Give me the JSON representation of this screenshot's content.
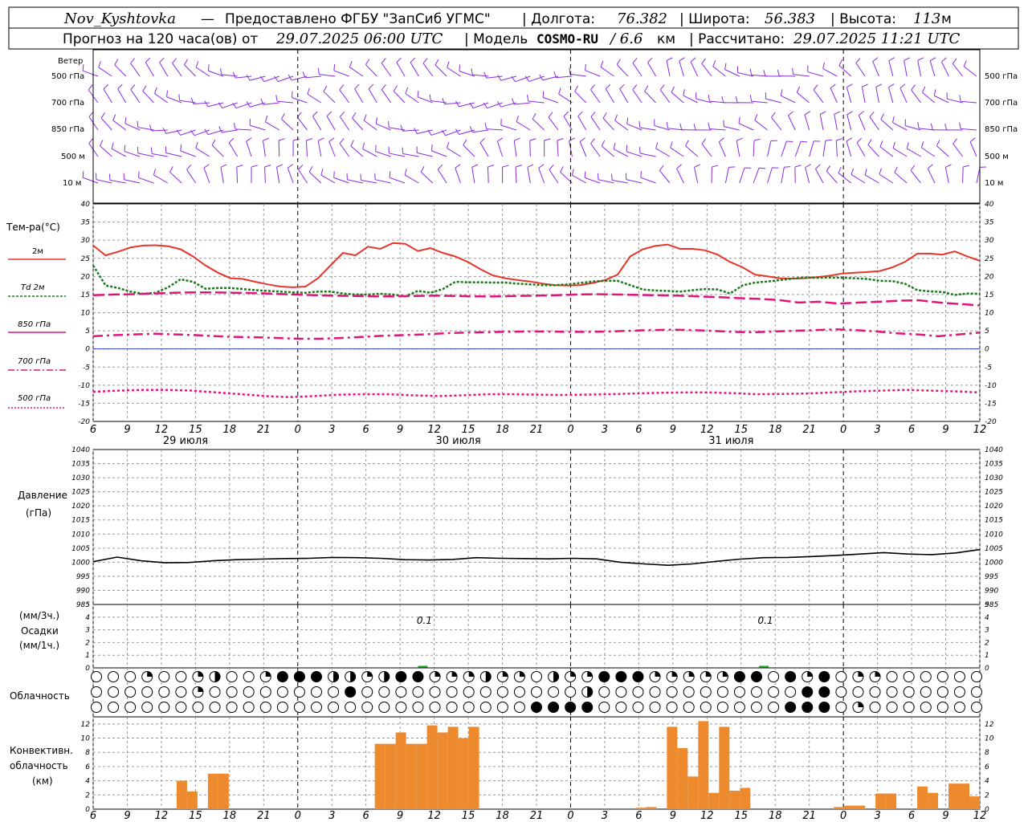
{
  "header": {
    "station": "Nov_Kyshtovka",
    "dash": "—",
    "provider": "Предоставлено ФГБУ \"ЗапСиб УГМС\"",
    "lon_label": "| Долгота:",
    "lon_value": "76.382",
    "lat_label": "| Широта:",
    "lat_value": "56.383",
    "alt_label": "| Высота:",
    "alt_value": "113",
    "alt_unit": "м",
    "forecast_label": "Прогноз на 120 часа(ов) от",
    "forecast_time": "29.07.2025 06:00 UTC",
    "model_label": "| Модель",
    "model_name": "COSMO-RU",
    "model_res": "/ 6.6",
    "model_res_unit": "км",
    "calc_label": "| Рассчитано:",
    "calc_time": "29.07.2025 11:21 UTC"
  },
  "wind_panel": {
    "title": "Ветер",
    "levels": [
      "500 гПа",
      "700 гПа",
      "850 гПа",
      "500 м",
      "10  м"
    ],
    "colors": {
      "barb": "#8a2be2"
    }
  },
  "temp_panel": {
    "title": "Тем-ра(°C)",
    "legend": [
      {
        "label": "2м",
        "color": "#e8352c",
        "style": "solid"
      },
      {
        "label": "Td  2м",
        "color": "#1a7a1a",
        "style": "dotted"
      },
      {
        "label": "850 гПа",
        "color": "#e0157a",
        "style": "dashed"
      },
      {
        "label": "700 гПа",
        "color": "#e0157a",
        "style": "dashdot"
      },
      {
        "label": "500 гПа",
        "color": "#e0157a",
        "style": "dotted"
      }
    ]
  },
  "pressure_panel": {
    "title1": "Давление",
    "title2": "(гПа)"
  },
  "precip_panel": {
    "title1": "(мм/3ч.)",
    "title2": "Осадки",
    "title3": "(мм/1ч.)"
  },
  "cloud_panel": {
    "title": "Облачность"
  },
  "conv_panel": {
    "title1": "Конвективн.",
    "title2": "облачность",
    "title3": "(км)"
  },
  "x_tick_labels": [
    "6",
    "9",
    "12",
    "15",
    "18",
    "21",
    "0",
    "3",
    "6",
    "9",
    "12",
    "15",
    "18",
    "21",
    "0",
    "3",
    "6",
    "9",
    "12",
    "15",
    "18",
    "21",
    "0",
    "3",
    "6",
    "9",
    "12"
  ],
  "date_labels": [
    "29 июля",
    "30 июля",
    "31 июля"
  ],
  "colors": {
    "t2m": "#e8352c",
    "td": "#1a7a1a",
    "upper": "#e0157a",
    "zero": "#3040e0",
    "pressure": "#000000",
    "conv": "#ee8a2e",
    "precip": "#22aa22",
    "grid": "#999999"
  },
  "chart_data": [
    {
      "type": "line",
      "title": "Тем-ра(°C)",
      "x_hours_from_start": [
        0,
        1,
        2,
        3,
        4,
        5,
        6,
        7,
        8,
        9,
        10,
        11,
        12,
        13,
        14,
        15,
        16,
        17,
        18,
        19,
        20,
        21,
        22,
        23,
        24,
        25,
        26,
        27,
        28,
        29,
        30,
        31,
        32,
        33,
        34,
        35,
        36,
        37,
        38,
        39,
        40,
        41,
        42,
        43,
        44,
        45,
        46,
        47,
        48,
        49,
        50,
        51,
        52,
        53,
        54,
        55,
        56,
        57,
        58,
        59,
        60,
        61,
        62,
        63,
        64,
        65,
        66,
        67,
        68,
        69,
        70,
        71,
        72,
        73,
        74,
        75,
        76,
        77,
        78
      ],
      "ylim": [
        -20,
        40
      ],
      "series": [
        {
          "name": "2м",
          "values": [
            28.5,
            25.8,
            26.8,
            28.0,
            28.5,
            28.6,
            28.3,
            27.5,
            25.5,
            23.0,
            21.0,
            19.5,
            19.3,
            18.5,
            17.8,
            17.2,
            17.0,
            17.2,
            19.5,
            23.0,
            26.5,
            25.8,
            28.2,
            27.6,
            29.2,
            29.0,
            27.0,
            27.8,
            26.5,
            25.5,
            24.0,
            22.0,
            20.3,
            19.5,
            19.0,
            18.6,
            18.0,
            17.6,
            17.5,
            17.6,
            18.2,
            19.0,
            20.5,
            25.5,
            27.5,
            28.4,
            28.8,
            27.6,
            27.6,
            27.2,
            26.0,
            24.0,
            22.5,
            20.5,
            20.0,
            19.5,
            19.4,
            19.5,
            19.8,
            20.2,
            20.8,
            21.0,
            21.2,
            21.5,
            22.5,
            24.0,
            26.3,
            26.3,
            26.0,
            26.9,
            25.5,
            24.3
          ]
        },
        {
          "name": "Td  2м",
          "values": [
            23.0,
            17.5,
            16.8,
            15.8,
            15.2,
            15.5,
            17.0,
            19.2,
            18.5,
            16.6,
            16.8,
            16.8,
            16.5,
            16.2,
            16.0,
            15.8,
            15.6,
            15.5,
            15.8,
            15.8,
            15.3,
            15.0,
            15.0,
            15.2,
            15.0,
            14.5,
            16.0,
            15.5,
            16.5,
            18.5,
            18.4,
            18.4,
            18.3,
            18.3,
            18.0,
            17.8,
            17.6,
            17.6,
            17.8,
            18.2,
            18.6,
            18.8,
            18.8,
            17.6,
            16.4,
            16.1,
            16.0,
            15.8,
            16.2,
            16.5,
            16.4,
            15.3,
            17.5,
            18.3,
            18.6,
            19.0,
            19.4,
            19.7,
            19.6,
            19.7,
            19.6,
            19.5,
            19.3,
            18.8,
            18.7,
            18.0,
            16.2,
            15.9,
            15.7,
            14.9,
            15.3,
            15.2
          ]
        },
        {
          "name": "850 гПа",
          "values": [
            14.8,
            15.0,
            15.1,
            15.3,
            15.5,
            15.6,
            15.6,
            15.5,
            15.4,
            15.2,
            15.0,
            14.8,
            14.7,
            14.6,
            14.5,
            14.5,
            14.6,
            14.7,
            14.6,
            14.5,
            14.5,
            14.6,
            14.7,
            14.8,
            15.0,
            15.1,
            15.0,
            14.9,
            14.8,
            14.7,
            14.5,
            14.3,
            14.0,
            13.8,
            13.5,
            12.8,
            13.0,
            12.5,
            12.8,
            13.0,
            13.3,
            13.4,
            12.8,
            12.4,
            12.0
          ]
        },
        {
          "name": "700 гПа",
          "values": [
            3.5,
            3.8,
            4.0,
            4.2,
            4.0,
            3.8,
            3.5,
            3.3,
            3.2,
            3.0,
            2.8,
            2.8,
            3.0,
            3.3,
            3.6,
            3.8,
            4.0,
            4.3,
            4.5,
            4.6,
            4.7,
            4.8,
            4.8,
            4.7,
            4.7,
            4.8,
            5.0,
            5.2,
            5.3,
            5.2,
            5.0,
            4.7,
            4.6,
            4.8,
            5.0,
            5.2,
            5.4,
            5.2,
            4.8,
            4.3,
            4.0,
            3.5,
            4.0,
            4.5
          ]
        },
        {
          "name": "500 гПа",
          "values": [
            -11.8,
            -11.5,
            -11.3,
            -11.3,
            -11.5,
            -12.0,
            -12.5,
            -13.0,
            -13.3,
            -13.0,
            -12.6,
            -12.5,
            -12.5,
            -12.8,
            -13.0,
            -12.8,
            -12.5,
            -12.5,
            -12.6,
            -12.7,
            -12.6,
            -12.5,
            -12.3,
            -12.1,
            -12.0,
            -12.0,
            -12.2,
            -12.5,
            -12.4,
            -12.3,
            -12.0,
            -11.7,
            -11.5,
            -11.3,
            -11.5,
            -11.7,
            -12.0
          ]
        }
      ]
    },
    {
      "type": "line",
      "title": "Давление",
      "ylabel": "(гПа)",
      "ylim": [
        985,
        1040
      ],
      "series": [
        {
          "name": "Давление",
          "values": [
            1000.2,
            1001.8,
            1000.5,
            999.8,
            999.9,
            1000.5,
            1000.9,
            1001.1,
            1001.3,
            1001.4,
            1001.7,
            1001.6,
            1001.4,
            1000.9,
            1000.8,
            1001.0,
            1001.6,
            1001.4,
            1001.3,
            1001.2,
            1001.4,
            1001.2,
            1000.0,
            999.4,
            998.9,
            999.4,
            1000.3,
            1001.1,
            1001.6,
            1001.7,
            1002.0,
            1002.4,
            1002.9,
            1003.4,
            1002.9,
            1002.7,
            1003.3,
            1004.5
          ]
        }
      ]
    },
    {
      "type": "bar",
      "title": "Осадки",
      "ylim": [
        0,
        5
      ],
      "annotations": [
        "0.1",
        "0.1"
      ],
      "values": [
        0,
        0.1,
        0.1
      ]
    },
    {
      "type": "bar",
      "title": "Конвективн. облачность (км)",
      "ylim": [
        0,
        13
      ],
      "bars_hours": [
        [
          8,
          9,
          4.0
        ],
        [
          9,
          10,
          2.5
        ],
        [
          11,
          12,
          5.0
        ],
        [
          12,
          13,
          5.0
        ],
        [
          27,
          28,
          9.2
        ],
        [
          28,
          29,
          9.2
        ],
        [
          29,
          30,
          10.8
        ],
        [
          30,
          31,
          9.2
        ],
        [
          31,
          32,
          9.2
        ],
        [
          32,
          33,
          11.8
        ],
        [
          33,
          34,
          10.8
        ],
        [
          34,
          35,
          11.6
        ],
        [
          35,
          36,
          10.0
        ],
        [
          36,
          37,
          11.6
        ],
        [
          52,
          53,
          0.2
        ],
        [
          53,
          54,
          0.3
        ],
        [
          55,
          56,
          11.6
        ],
        [
          56,
          57,
          8.6
        ],
        [
          57,
          58,
          4.6
        ],
        [
          58,
          59,
          12.4
        ],
        [
          59,
          60,
          2.3
        ],
        [
          60,
          61,
          11.6
        ],
        [
          61,
          62,
          2.6
        ],
        [
          62,
          63,
          3.0
        ],
        [
          71,
          72,
          0.3
        ],
        [
          72,
          73,
          0.5
        ],
        [
          73,
          74,
          0.5
        ],
        [
          75,
          76,
          2.2
        ],
        [
          76,
          77,
          2.2
        ],
        [
          79,
          80,
          3.2
        ],
        [
          80,
          81,
          2.3
        ],
        [
          82,
          83,
          3.6
        ],
        [
          83,
          84,
          3.6
        ],
        [
          84,
          85,
          1.8
        ]
      ],
      "series": []
    }
  ]
}
